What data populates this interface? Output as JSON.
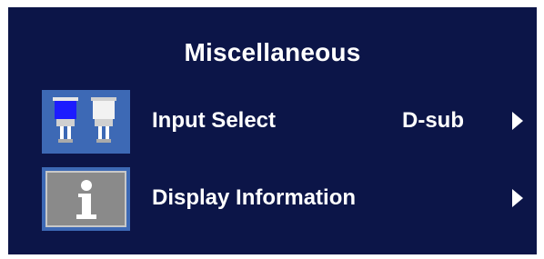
{
  "menu": {
    "title": "Miscellaneous",
    "items": [
      {
        "label": "Input Select",
        "value": "D-sub",
        "icon": "input-connectors-icon",
        "arrow_icon": "arrow-right-icon"
      },
      {
        "label": "Display Information",
        "value": "",
        "icon": "info-icon",
        "arrow_icon": "arrow-right-icon"
      }
    ]
  },
  "colors": {
    "osd_background": "#0c1548",
    "icon_tile": "#3d69b5",
    "text": "#ffffff",
    "info_tile_gray": "#8a8a8a"
  }
}
